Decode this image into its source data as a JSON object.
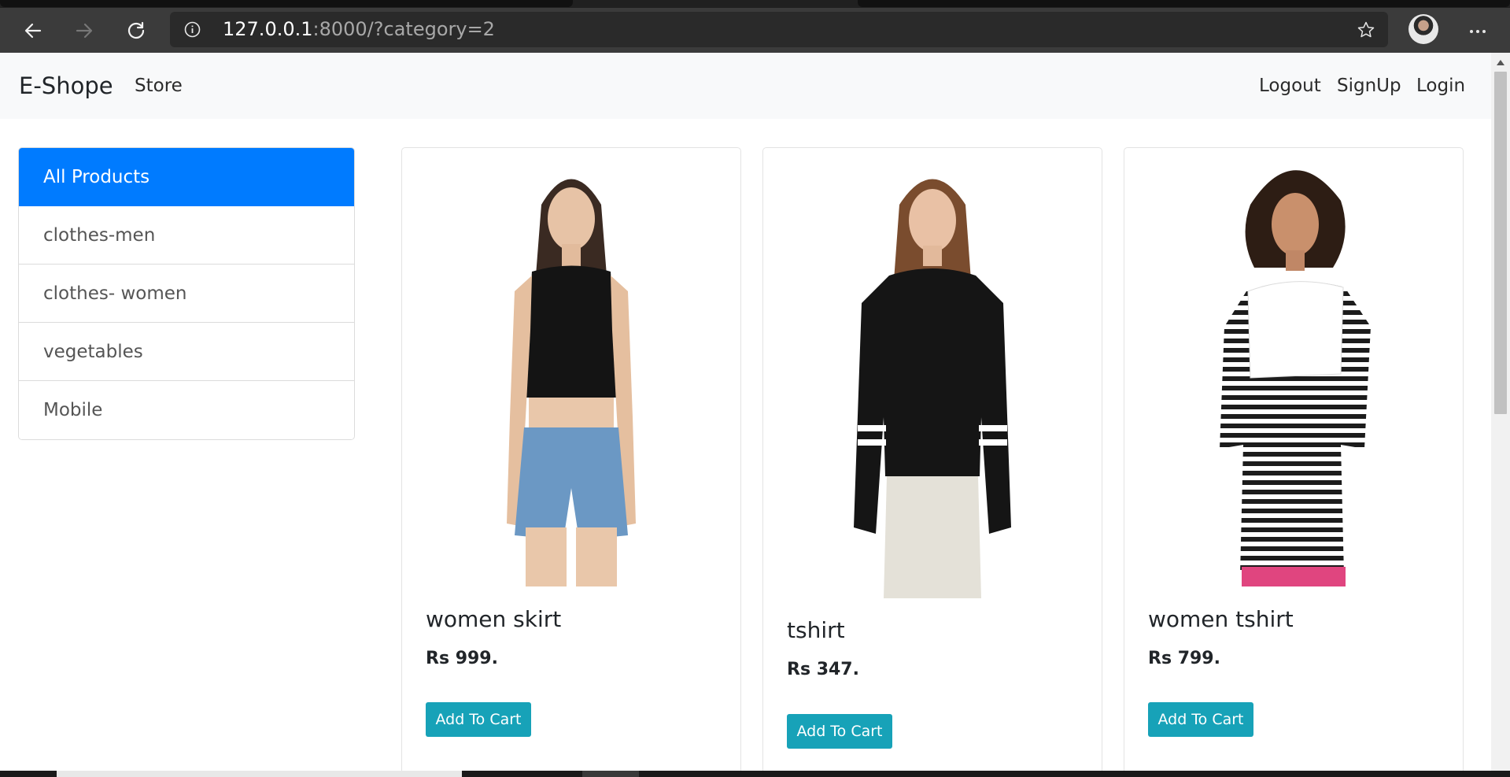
{
  "browser": {
    "url_host": "127.0.0.1",
    "url_rest": ":8000/?category=2",
    "icons": [
      "back-arrow-icon",
      "forward-arrow-icon",
      "refresh-icon",
      "site-info-icon",
      "favorite-star-icon",
      "profile-avatar",
      "more-menu-icon"
    ]
  },
  "navbar": {
    "brand": "E-Shope",
    "store": "Store",
    "logout": "Logout",
    "signup": "SignUp",
    "login": "Login"
  },
  "categories": [
    {
      "label": "All Products",
      "active": true
    },
    {
      "label": "clothes-men",
      "active": false
    },
    {
      "label": "clothes- women",
      "active": false
    },
    {
      "label": "vegetables",
      "active": false
    },
    {
      "label": "Mobile",
      "active": false
    }
  ],
  "products": [
    {
      "title": "women skirt",
      "price": "Rs 999.",
      "button": "Add To Cart"
    },
    {
      "title": "tshirt",
      "price": "Rs 347.",
      "button": "Add To Cart"
    },
    {
      "title": "women tshirt",
      "price": "Rs 799.",
      "button": "Add To Cart"
    }
  ],
  "colors": {
    "active_category": "#007bff",
    "cart_button": "#17a2b8",
    "navbar_bg": "#f8f9fa",
    "browser_toolbar": "#3b3b3b"
  }
}
